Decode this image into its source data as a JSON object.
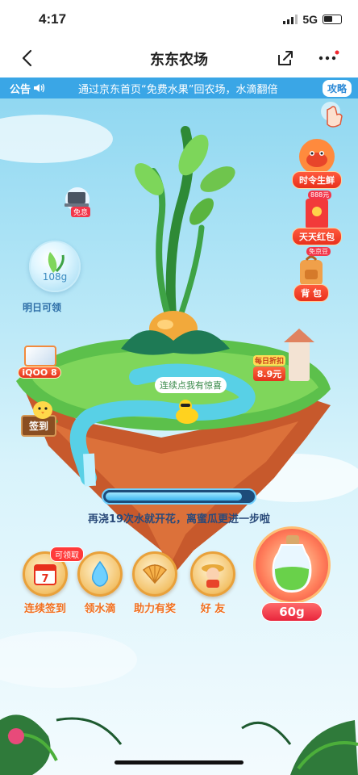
{
  "status": {
    "time": "4:17",
    "network": "5G"
  },
  "nav": {
    "title": "东东农场"
  },
  "notice": {
    "label": "公告",
    "text": "通过京东首页“免费水果”回农场，水滴翻倍",
    "button": "攻略"
  },
  "side_right": [
    {
      "label": "时令生鲜",
      "icon": "crab-icon"
    },
    {
      "label": "天天红包",
      "icon": "red-envelope-icon",
      "badge": "888元"
    },
    {
      "label": "背 包",
      "icon": "backpack-icon",
      "badge": "免京豆"
    }
  ],
  "side_left": {
    "ad_badge": "免息",
    "water": {
      "value": "108g",
      "label": "明日可领"
    },
    "promo": "iQOO 8",
    "signin": "签到"
  },
  "island": {
    "hint": "连续点我有惊喜",
    "daily_tag": "每日折扣",
    "daily_price": "8.9元"
  },
  "progress": {
    "fraction": 0.93,
    "text": "再浇19次水就开花，离蜜瓜更进一步啦"
  },
  "bottom_actions": [
    {
      "label": "连续签到",
      "icon": "calendar-icon",
      "badge": "可领取",
      "day": "7"
    },
    {
      "label": "领水滴",
      "icon": "water-drop-icon"
    },
    {
      "label": "助力有奖",
      "icon": "shell-icon"
    },
    {
      "label": "好 友",
      "icon": "farmer-icon"
    }
  ],
  "bottle": {
    "value": "60g"
  },
  "colors": {
    "accent": "#3aa6e6",
    "orange": "#f07020",
    "red": "#e8301c"
  }
}
